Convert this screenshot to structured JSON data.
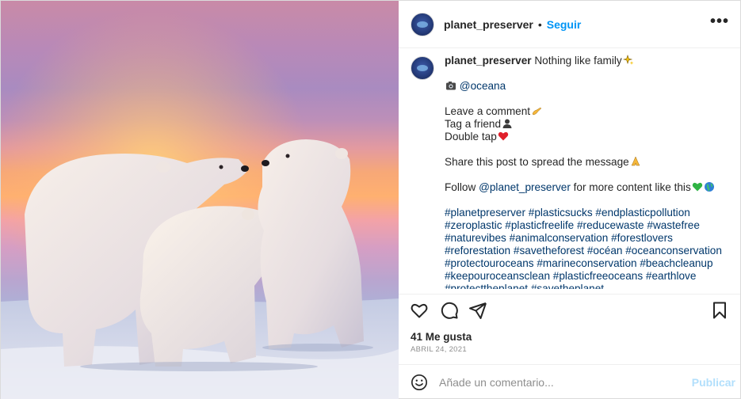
{
  "post": {
    "username": "planet_preserver",
    "separator": "•",
    "follow_label": "Seguir",
    "more_label": "•••"
  },
  "caption": {
    "username": "planet_preserver",
    "first_line": "Nothing like family",
    "credit": "@oceana",
    "leave_comment": "Leave a comment",
    "tag_friend": "Tag a friend",
    "double_tap": "Double tap",
    "share": "Share this post to spread the message",
    "follow_prefix": "Follow ",
    "follow_handle": "@planet_preserver",
    "follow_suffix": " for more content like this",
    "hashtags": "#planetpreserver #plasticsucks #endplasticpollution #zeroplastic #plasticfreelife #reducewaste #wastefree #naturevibes #animalconservation #forestlovers #reforestation #savetheforest #océan #oceanconservation #protectouroceans #marineconservation #beachcleanup #keepouroceansclean #plasticfreeoceans #earthlove #protecttheplanet #savetheplanet"
  },
  "stats": {
    "likes": "41 Me gusta",
    "date": "ABRIL 24, 2021"
  },
  "comment": {
    "placeholder": "Añade un comentario...",
    "publish_label": "Publicar"
  },
  "colors": {
    "link_blue": "#0095f6",
    "publish_disabled": "#b2dffc",
    "text": "#262626",
    "muted": "#8e8e8e"
  },
  "icons": [
    "sparkles-icon",
    "camera-icon",
    "writing-hand-icon",
    "person-icon",
    "red-heart-icon",
    "folded-hands-icon",
    "green-heart-icon",
    "globe-icon",
    "heart-icon",
    "comment-icon",
    "share-icon",
    "bookmark-icon",
    "emoji-icon"
  ]
}
